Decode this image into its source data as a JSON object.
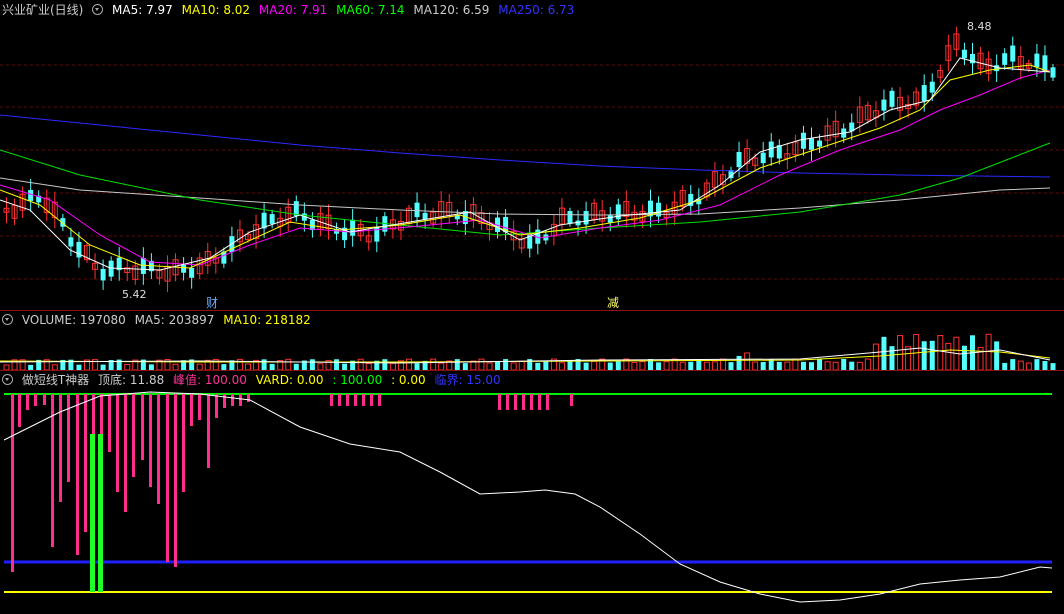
{
  "main": {
    "title": "兴业矿业(日线)",
    "ma": [
      {
        "label": "MA5: 7.97",
        "color": "#ffffff"
      },
      {
        "label": "MA10: 8.02",
        "color": "#ffff00"
      },
      {
        "label": "MA20: 7.91",
        "color": "#ff00ff"
      },
      {
        "label": "MA60: 7.14",
        "color": "#00ff00"
      },
      {
        "label": "MA120: 6.59",
        "color": "#cccccc"
      },
      {
        "label": "MA250: 6.73",
        "color": "#3333ff"
      }
    ],
    "high_label": "8.48",
    "low_label": "5.42",
    "marker1": "财",
    "marker2": "减"
  },
  "volume": {
    "label": "VOLUME: 197080",
    "ma5": "MA5: 203897",
    "ma10": "MA10: 218182"
  },
  "indicator": {
    "name": "做短线T神器",
    "top": "顶底: 11.88",
    "peak": "峰值: 100.00",
    "vard": "VARD: 0.00",
    "v100": ": 100.00",
    "v0": ": 0.00",
    "critical": "临界: 15.00"
  }
}
